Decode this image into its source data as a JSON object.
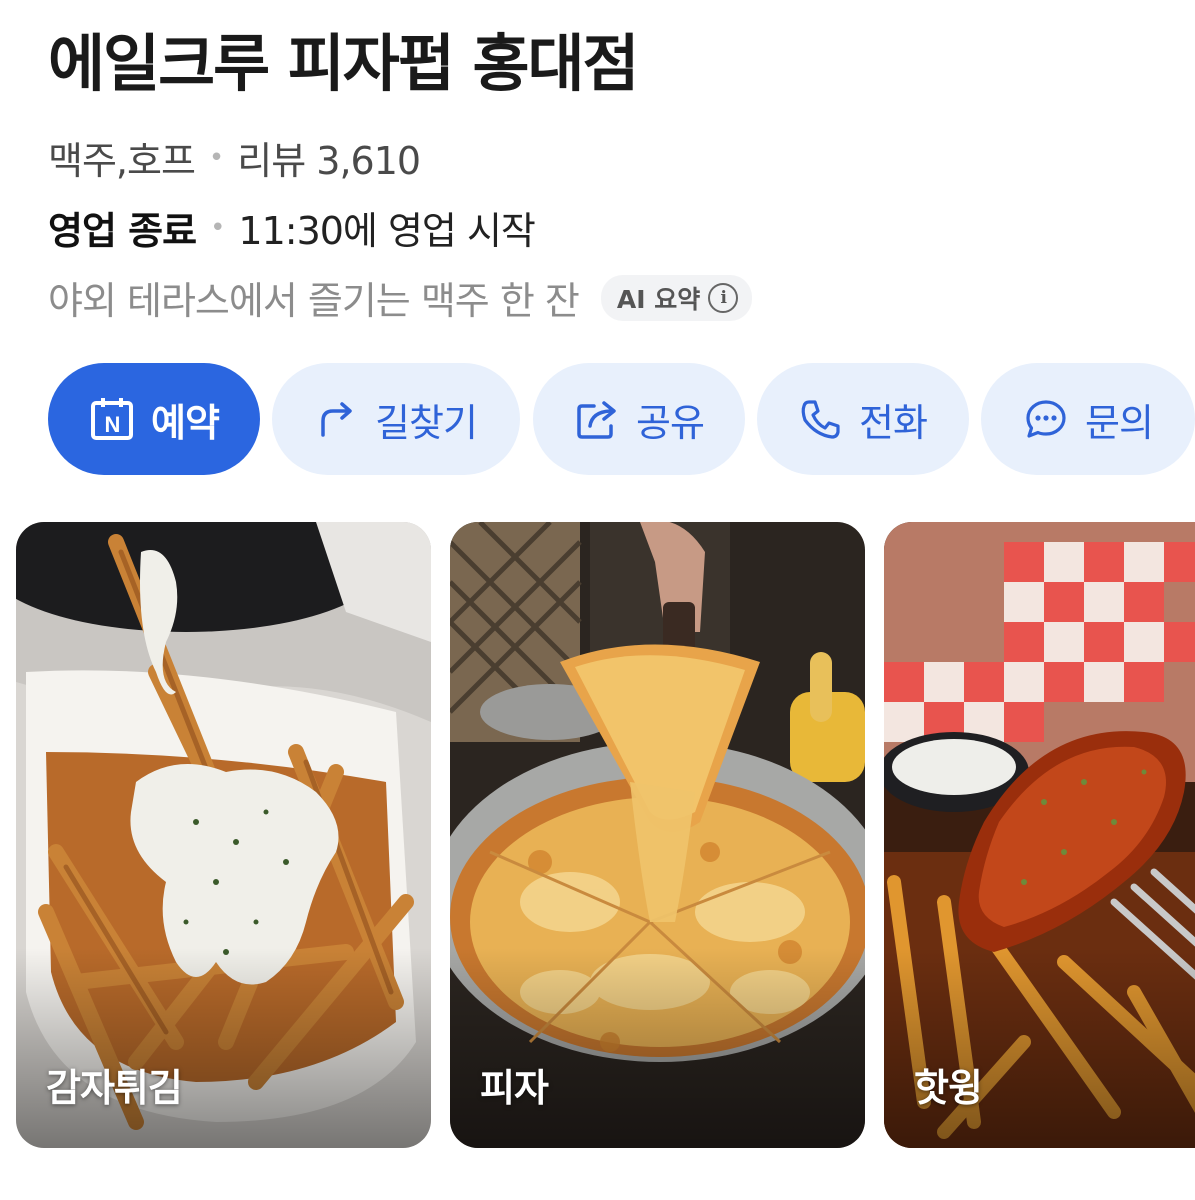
{
  "place": {
    "name": "에일크루 피자펍 홍대점",
    "category": "맥주,호프",
    "reviews": "리뷰 3,610",
    "status": "영업 종료",
    "hours": "11:30에 영업 시작",
    "summary": "야외 테라스에서 즐기는 맥주 한 잔",
    "ai_badge": "AI 요약",
    "info_glyph": "i"
  },
  "actions": [
    {
      "label": "예약",
      "icon": "naver-reservation-icon"
    },
    {
      "label": "길찾기",
      "icon": "directions-arrow-icon"
    },
    {
      "label": "공유",
      "icon": "share-icon"
    },
    {
      "label": "전화",
      "icon": "phone-icon"
    },
    {
      "label": "문의",
      "icon": "chat-bubble-icon"
    }
  ],
  "reservation_icon_letter": "N",
  "menu_cards": [
    {
      "label": "감자튀김"
    },
    {
      "label": "피자"
    },
    {
      "label": "핫윙"
    }
  ],
  "colors": {
    "primary": "#2b66e0",
    "button_bg": "#e8f0fc",
    "button_text": "#2f63d8"
  }
}
